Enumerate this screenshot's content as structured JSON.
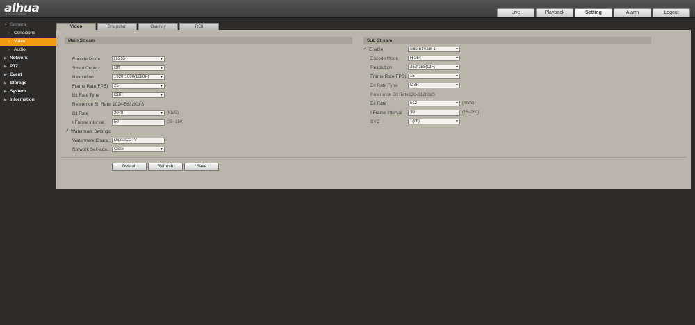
{
  "brand": {
    "logo": "alhua",
    "tagline": "TECHNOLOGY"
  },
  "topnav": [
    {
      "label": "Live",
      "active": false
    },
    {
      "label": "Playback",
      "active": false
    },
    {
      "label": "Setting",
      "active": true
    },
    {
      "label": "Alarm",
      "active": false
    },
    {
      "label": "Logout",
      "active": false
    }
  ],
  "sidebar": {
    "camera": "Camera",
    "conditions": "Conditions",
    "video": "Video",
    "audio": "Audio",
    "network": "Network",
    "ptz": "PTZ",
    "event": "Event",
    "storage": "Storage",
    "system": "System",
    "information": "Information"
  },
  "tabs": [
    "Video",
    "Snapshot",
    "Overlay",
    "ROI"
  ],
  "main_stream": {
    "title": "Main Stream",
    "encode_mode_label": "Encode Mode",
    "encode_mode": "H.265",
    "smart_codec_label": "Smart Codec",
    "smart_codec": "Off",
    "resolution_label": "Resolution",
    "resolution": "1920*1080(1080P)",
    "frame_rate_label": "Frame Rate(FPS)",
    "frame_rate": "25",
    "bit_rate_type_label": "Bit Rate Type",
    "bit_rate_type": "CBR",
    "ref_bit_rate_label": "Reference Bit Rate",
    "ref_bit_rate": "1024-5632Kb/S",
    "bit_rate_label": "Bit Rate",
    "bit_rate": "2048",
    "bit_rate_unit": "(Kb/S)",
    "iframe_label": "I Frame Interval",
    "iframe": "50",
    "iframe_range": "(25~150)",
    "watermark_label": "Watermark Settings",
    "watermark_chars_label": "Watermark Chara...",
    "watermark_chars": "DigitalCCTV",
    "network_selfadapt_label": "Network Self-ada...",
    "network_selfadapt": "Close"
  },
  "sub_stream": {
    "title": "Sub Stream",
    "enable_label": "Enable",
    "stream": "Sub Stream 1",
    "encode_mode_label": "Encode Mode",
    "encode_mode": "H.264",
    "resolution_label": "Resolution",
    "resolution": "352*288(CIF)",
    "frame_rate_label": "Frame Rate(FPS)",
    "frame_rate": "15",
    "bit_rate_type_label": "Bit Rate Type",
    "bit_rate_type": "CBR",
    "ref_bit_rate_label": "Reference Bit Rate",
    "ref_bit_rate": "136-512Kb/S",
    "bit_rate_label": "Bit Rate",
    "bit_rate": "512",
    "bit_rate_unit": "(Kb/S)",
    "iframe_label": "I Frame Interval",
    "iframe": "30",
    "iframe_range": "(15~150)",
    "svc_label": "SVC",
    "svc": "1(off)"
  },
  "buttons": {
    "default": "Default",
    "refresh": "Refresh",
    "save": "Save"
  }
}
